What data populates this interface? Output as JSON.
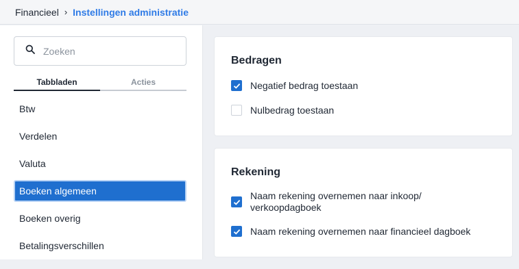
{
  "breadcrumb": {
    "root": "Financieel",
    "separator": "›",
    "current": "Instellingen administratie"
  },
  "sidebar": {
    "search_placeholder": "Zoeken",
    "tabs": [
      {
        "label": "Tabbladen",
        "active": true
      },
      {
        "label": "Acties",
        "active": false
      }
    ],
    "items": [
      {
        "label": "Btw"
      },
      {
        "label": "Verdelen"
      },
      {
        "label": "Valuta"
      },
      {
        "label": "Boeken algemeen",
        "selected": true
      },
      {
        "label": "Boeken overig"
      },
      {
        "label": "Betalingsverschillen"
      }
    ]
  },
  "sections": [
    {
      "title": "Bedragen",
      "options": [
        {
          "label": "Negatief bedrag toestaan",
          "checked": true
        },
        {
          "label": "Nulbedrag toestaan",
          "checked": false
        }
      ]
    },
    {
      "title": "Rekening",
      "options": [
        {
          "label": "Naam rekening overnemen naar inkoop/ verkoopdagboek",
          "checked": true
        },
        {
          "label": "Naam rekening overnemen naar financieel dagboek",
          "checked": true
        }
      ]
    }
  ],
  "colors": {
    "accent": "#1f6fcf",
    "breadcrumb_link": "#2f7be6"
  }
}
